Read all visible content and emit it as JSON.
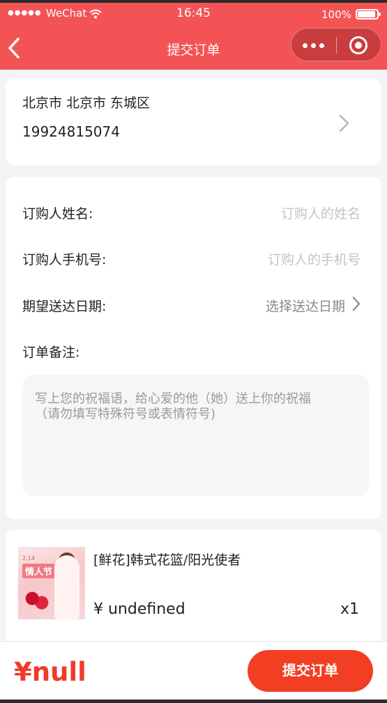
{
  "status_bar": {
    "signal": "●●●●●",
    "carrier": "WeChat",
    "time": "16:45",
    "battery": "100%"
  },
  "header": {
    "title": "提交订单",
    "back_icon": "chevron-left-icon",
    "menu_icon": "more-dots-icon",
    "close_icon": "target-close-icon",
    "color": "#f45355"
  },
  "address": {
    "region": "北京市 北京市 东城区",
    "phone": "19924815074"
  },
  "form": {
    "name_label": "订购人姓名:",
    "name_placeholder": "订购人的姓名",
    "phone_label": "订购人手机号:",
    "phone_placeholder": "订购人的手机号",
    "date_label": "期望送达日期:",
    "date_value": "选择送达日期",
    "remark_label": "订单备注:",
    "remark_placeholder": "写上您的祝福语，给心爱的他（她）送上你的祝福\n（请勿填写特殊符号或表情符号)"
  },
  "product": {
    "name": "[鲜花]韩式花篮/阳光使者",
    "price": "¥ undefined",
    "quantity": "x1",
    "image_caption": "情人节",
    "image_subcaption": "2.14"
  },
  "footer": {
    "total": "¥null",
    "submit_label": "提交订单",
    "accent": "#f23f24"
  }
}
